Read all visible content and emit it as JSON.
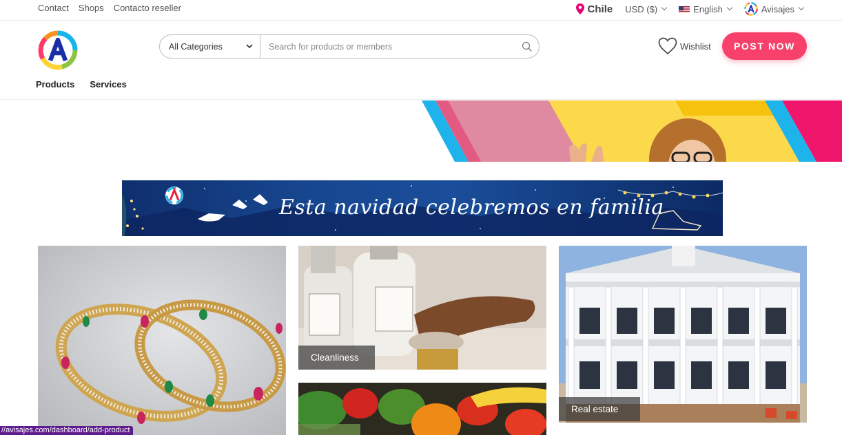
{
  "topbar": {
    "links": [
      "Contact",
      "Shops",
      "Contacto reseller"
    ],
    "location": "Chile",
    "currency": "USD ($)",
    "language": "English",
    "account": "Avisajes"
  },
  "header": {
    "nav": [
      "Products",
      "Services"
    ],
    "search": {
      "category": "All Categories",
      "placeholder": "Search for products or members"
    },
    "wishlist_label": "Wishlist",
    "post_button": "POST NOW"
  },
  "banner": {
    "text": "Esta navidad celebremos en familia"
  },
  "categories": [
    {
      "name": "jewelry",
      "label": ""
    },
    {
      "name": "cleanliness",
      "label": "Cleanliness"
    },
    {
      "name": "real-estate",
      "label": "Real estate"
    },
    {
      "name": "food",
      "label": ""
    }
  ],
  "status_bar": {
    "url": "//avisajes.com/dashboard/add-product"
  },
  "colors": {
    "accent": "#f7416a",
    "location_pin": "#e5006d"
  }
}
